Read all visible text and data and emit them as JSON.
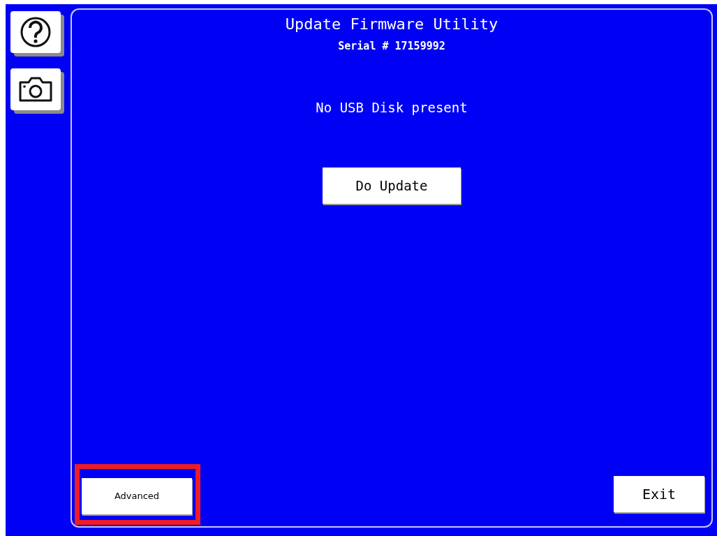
{
  "side_buttons": [
    {
      "kind": "help"
    },
    {
      "kind": "camera"
    }
  ],
  "panel": {
    "title": "Update Firmware Utility",
    "serial": "Serial # 17159992",
    "message": "No USB Disk present"
  },
  "update_button": {
    "label": "Do Update"
  },
  "advanced_button": {
    "label": "Advanced",
    "highlighted": true
  },
  "exit_button": {
    "label": "Exit"
  }
}
